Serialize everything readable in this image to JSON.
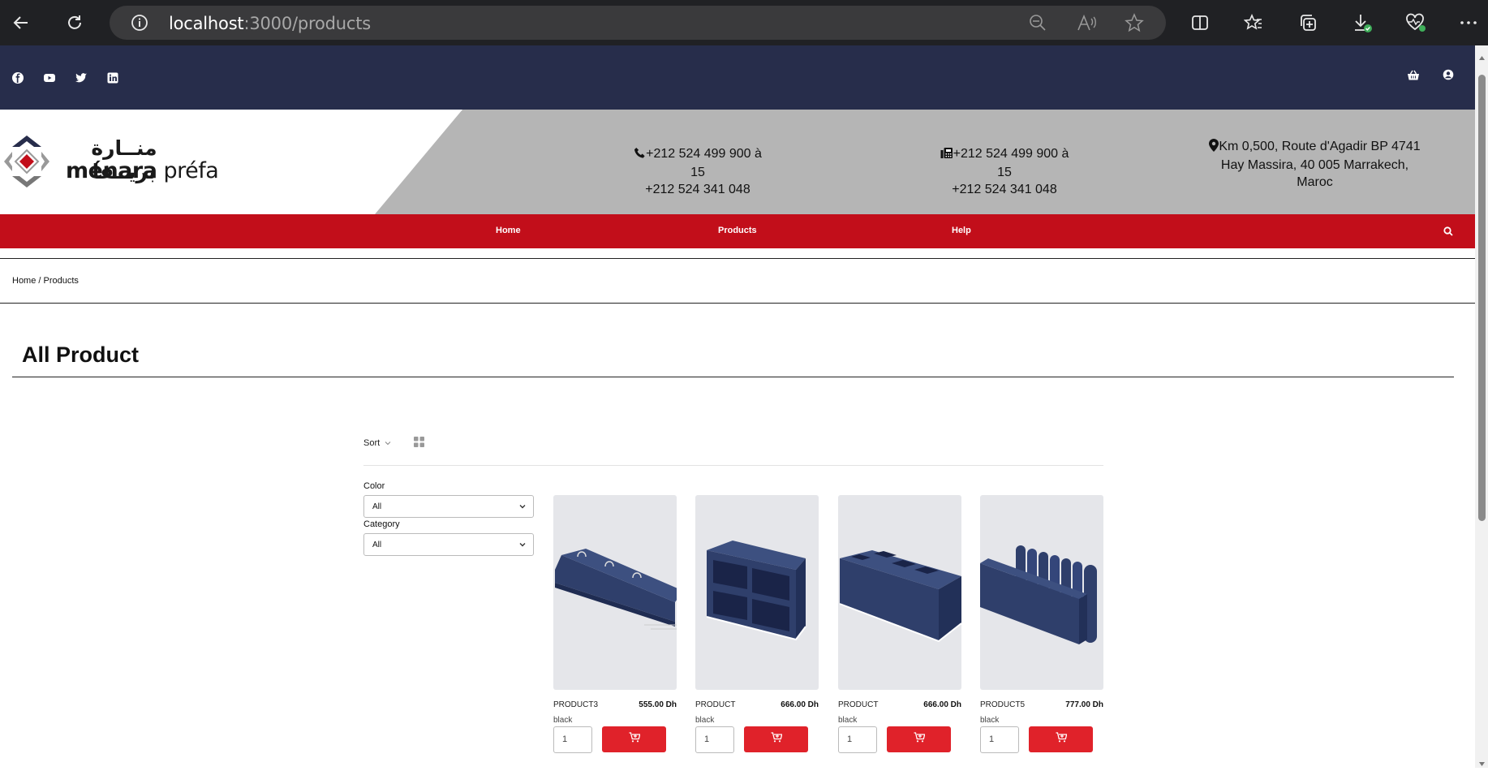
{
  "browser": {
    "url_host": "localhost",
    "url_path": ":3000/products"
  },
  "brand": {
    "arabic_name": "منــارة بريــفا",
    "name": "ménara",
    "suffix": "préfa"
  },
  "contact": {
    "phone_line1": "+212 524 499 900 à 15",
    "phone_line2": "+212 524 341 048",
    "fax_line1": "+212 524 499 900 à 15",
    "fax_line2": "+212 524 341 048",
    "address_line1": "Km 0,500, Route d'Agadir BP 4741",
    "address_line2": "Hay Massira, 40 005 Marrakech,",
    "address_line3": "Maroc"
  },
  "nav": {
    "home": "Home",
    "products": "Products",
    "help": "Help"
  },
  "breadcrumb": "Home / Products",
  "page_title": "All Product",
  "toolbar": {
    "sort_label": "Sort"
  },
  "filters": {
    "color_label": "Color",
    "color_value": "All",
    "category_label": "Category",
    "category_value": "All"
  },
  "products": [
    {
      "name": "PRODUCT3",
      "price": "555.00 Dh",
      "color": "black",
      "qty": "1"
    },
    {
      "name": "PRODUCT",
      "price": "666.00 Dh",
      "color": "black",
      "qty": "1"
    },
    {
      "name": "PRODUCT",
      "price": "666.00 Dh",
      "color": "black",
      "qty": "1"
    },
    {
      "name": "PRODUCT5",
      "price": "777.00 Dh",
      "color": "black",
      "qty": "1"
    }
  ],
  "colors": {
    "top_bar": "#272d4b",
    "nav_red": "#c20e1a",
    "header_gray": "#b5b5b5",
    "cart_button": "#e0222a",
    "product_blue": "#2f3f6b"
  }
}
